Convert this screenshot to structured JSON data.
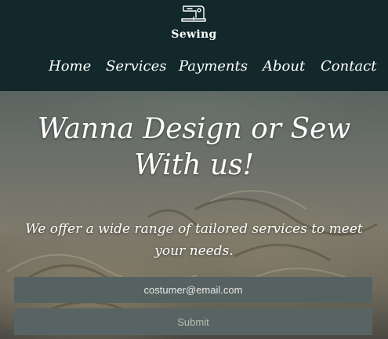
{
  "header": {
    "brand": "Sewing",
    "logo_icon": "sewing-machine-icon"
  },
  "nav": {
    "items": [
      {
        "label": "Home"
      },
      {
        "label": "Services"
      },
      {
        "label": "Payments"
      },
      {
        "label": "About"
      },
      {
        "label": "Contact"
      }
    ]
  },
  "hero": {
    "title": "Wanna Design or Sew With us!",
    "subtitle": "We offer a wide range of tailored services to meet your needs.",
    "email_placeholder": "costumer@email.com",
    "submit_label": "Submit"
  },
  "colors": {
    "header_bg": "#12282a",
    "input_bg": "#566262",
    "text": "#ffffff"
  }
}
